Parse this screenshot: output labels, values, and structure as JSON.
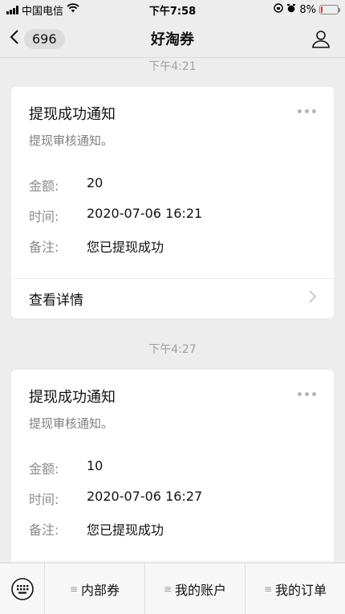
{
  "status_bar": {
    "carrier": "中国电信",
    "time": "下午7:58",
    "battery_percent": "8%",
    "battery_level": 0.08
  },
  "nav": {
    "back_badge": "696",
    "title": "好淘券"
  },
  "messages": [
    {
      "time": "下午4:21",
      "title": "提现成功通知",
      "subtitle": "提现审核通知。",
      "fields": [
        {
          "key": "金额:",
          "value": "20"
        },
        {
          "key": "时间:",
          "value": "2020-07-06 16:21"
        },
        {
          "key": "备注:",
          "value": "您已提现成功"
        }
      ],
      "detail_label": "查看详情"
    },
    {
      "time": "下午4:27",
      "title": "提现成功通知",
      "subtitle": "提现审核通知。",
      "fields": [
        {
          "key": "金额:",
          "value": "10"
        },
        {
          "key": "时间:",
          "value": "2020-07-06 16:27"
        },
        {
          "key": "备注:",
          "value": "您已提现成功"
        }
      ]
    }
  ],
  "bottom_menu": {
    "items": [
      "内部券",
      "我的账户",
      "我的订单"
    ]
  },
  "icons": {
    "back": "chevron-left-icon",
    "user": "user-icon",
    "more": "more-dots-icon",
    "keyboard": "keyboard-icon",
    "menu": "menu-lines-icon"
  }
}
